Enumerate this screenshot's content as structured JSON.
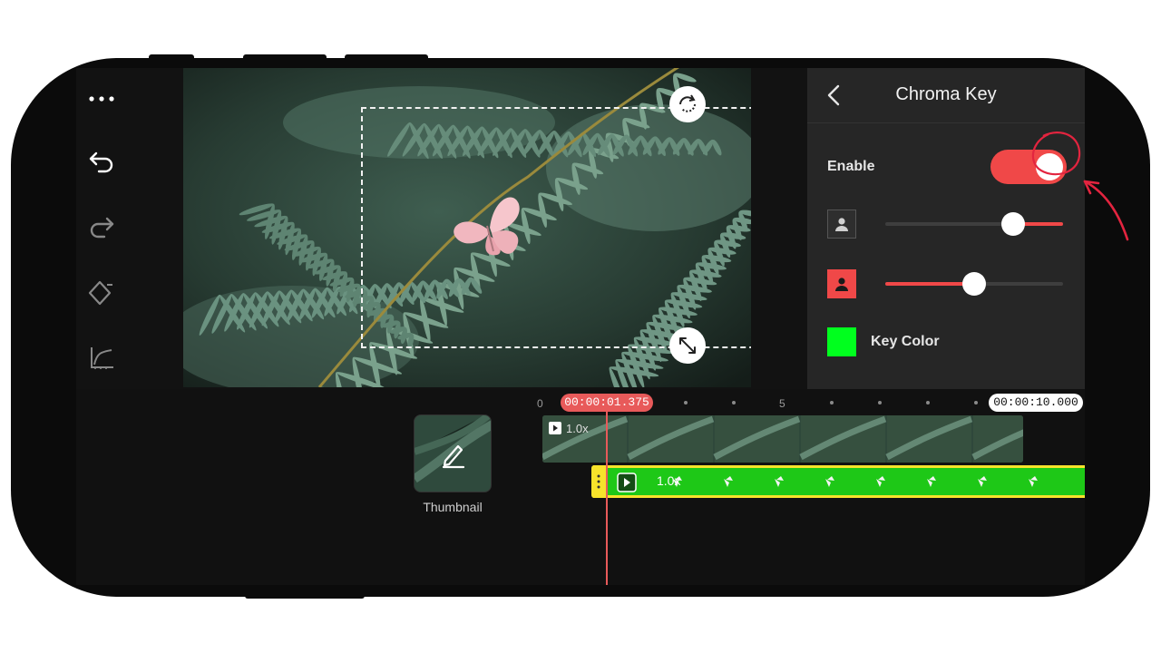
{
  "toolbar": {
    "more": "more-icon",
    "undo": "undo-icon",
    "redo": "redo-icon",
    "keyframe": "keyframe-icon",
    "curve": "speed-curve-icon",
    "split": "split-icon",
    "jump_start": "jump-start-icon",
    "jump_end": "jump-end-icon"
  },
  "panel": {
    "title": "Chroma Key",
    "enable_label": "Enable",
    "enable_on": true,
    "slider1_value": 0.72,
    "slider2_value": 0.5,
    "key_color_label": "Key Color",
    "key_color": "#00ff1e"
  },
  "timeline": {
    "ruler_start": "0",
    "ruler_mid": "5",
    "current_time": "00:00:01.375",
    "end_time": "00:00:10.000",
    "thumbnail_label": "Thumbnail",
    "video_clip_speed": "1.0x",
    "overlay_clip_speed": "1.0x"
  },
  "colors": {
    "accent": "#f04848",
    "chroma_green": "#1ec817",
    "clip_border": "#f7e32b"
  }
}
